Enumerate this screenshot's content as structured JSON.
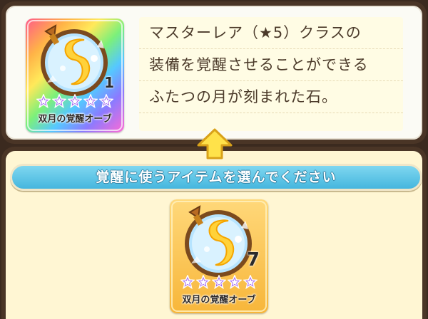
{
  "top_item": {
    "name": "双月の覚醒オーブ",
    "count": "1",
    "star_count": 5,
    "description": [
      "マスターレア（★5）クラスの",
      "装備を覚醒させることができる",
      "ふたつの月が刻まれた石。"
    ]
  },
  "banner": {
    "text": "覚醒に使うアイテムを選んでください"
  },
  "bottom_item": {
    "name": "双月の覚醒オーブ",
    "count": "7",
    "star_count": 5
  },
  "colors": {
    "frame": "#4a3526",
    "banner": "#45b6de",
    "star": "#9b5cf0",
    "arrow": "#ffe24a",
    "card_bg": "#f7b63a"
  },
  "icons": [
    "awakening-orb-icon",
    "star-icon",
    "up-arrow-icon"
  ]
}
